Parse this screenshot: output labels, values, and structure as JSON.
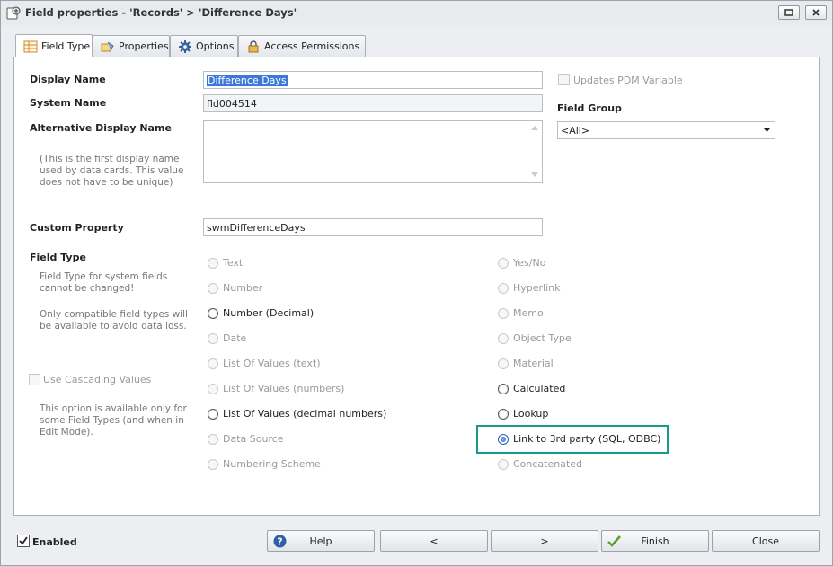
{
  "window": {
    "title": "Field properties - 'Records' > 'Difference Days'"
  },
  "tabs": [
    {
      "label": "Field Type",
      "icon": "table-icon"
    },
    {
      "label": "Properties",
      "icon": "properties-icon"
    },
    {
      "label": "Options",
      "icon": "gear-icon"
    },
    {
      "label": "Access Permissions",
      "icon": "lock-icon"
    }
  ],
  "form": {
    "display_name_label": "Display Name",
    "display_name_value": "Difference Days",
    "system_name_label": "System Name",
    "system_name_value": "fld004514",
    "alt_display_name_label": "Alternative Display Name",
    "alt_display_name_note": "(This is the first display name used by data cards. This value does not have to be unique)",
    "alt_display_name_value": "",
    "custom_property_label": "Custom Property",
    "custom_property_value": "swmDifferenceDays",
    "updates_pdm_label": "Updates PDM Variable",
    "field_group_label": "Field Group",
    "field_group_value": "<All>",
    "field_type_label": "Field Type",
    "field_type_note1": "Field Type for system fields cannot be changed!",
    "field_type_note2": "Only compatible field types will be available to avoid data loss.",
    "cascading_label": "Use Cascading Values",
    "cascading_note": "This option is available only for some Field Types (and when in Edit Mode)."
  },
  "field_types_left": [
    {
      "label": "Text",
      "enabled": false,
      "checked": false
    },
    {
      "label": "Number",
      "enabled": false,
      "checked": false
    },
    {
      "label": "Number (Decimal)",
      "enabled": true,
      "checked": false
    },
    {
      "label": "Date",
      "enabled": false,
      "checked": false
    },
    {
      "label": "List Of Values (text)",
      "enabled": false,
      "checked": false
    },
    {
      "label": "List Of Values (numbers)",
      "enabled": false,
      "checked": false
    },
    {
      "label": "List Of Values (decimal numbers)",
      "enabled": true,
      "checked": false
    },
    {
      "label": "Data Source",
      "enabled": false,
      "checked": false
    },
    {
      "label": "Numbering Scheme",
      "enabled": false,
      "checked": false
    }
  ],
  "field_types_right": [
    {
      "label": "Yes/No",
      "enabled": false,
      "checked": false
    },
    {
      "label": "Hyperlink",
      "enabled": false,
      "checked": false
    },
    {
      "label": "Memo",
      "enabled": false,
      "checked": false
    },
    {
      "label": "Object Type",
      "enabled": false,
      "checked": false
    },
    {
      "label": "Material",
      "enabled": false,
      "checked": false
    },
    {
      "label": "Calculated",
      "enabled": true,
      "checked": false
    },
    {
      "label": "Lookup",
      "enabled": true,
      "checked": false
    },
    {
      "label": "Link to 3rd party (SQL, ODBC)",
      "enabled": true,
      "checked": true
    },
    {
      "label": "Concatenated",
      "enabled": false,
      "checked": false
    }
  ],
  "footer": {
    "enabled_label": "Enabled",
    "help_label": "Help",
    "back_label": "<",
    "next_label": ">",
    "finish_label": "Finish",
    "close_label": "Close"
  },
  "colors": {
    "highlight": "#159b88",
    "selection": "#3b78d8"
  }
}
